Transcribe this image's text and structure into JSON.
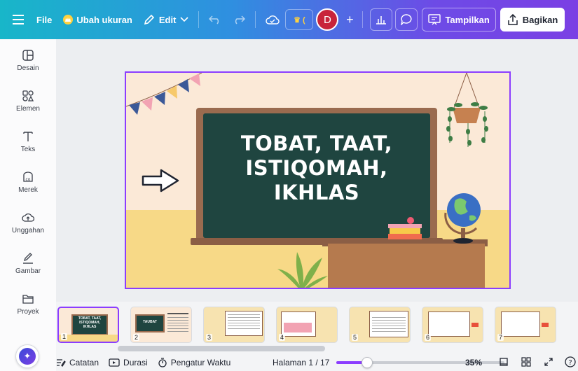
{
  "topbar": {
    "file_label": "File",
    "resize_label": "Ubah ukuran",
    "edit_label": "Edit",
    "avatar_initial": "D",
    "present_label": "Tampilkan",
    "share_label": "Bagikan"
  },
  "sidebar": {
    "items": [
      {
        "label": "Desain",
        "icon": "layout-icon"
      },
      {
        "label": "Elemen",
        "icon": "shapes-icon"
      },
      {
        "label": "Teks",
        "icon": "text-icon"
      },
      {
        "label": "Merek",
        "icon": "brand-icon"
      },
      {
        "label": "Unggahan",
        "icon": "upload-icon"
      },
      {
        "label": "Gambar",
        "icon": "draw-icon"
      },
      {
        "label": "Proyek",
        "icon": "folder-icon"
      }
    ]
  },
  "slide": {
    "title": "TOBAT, TAAT,\nISTIQOMAH,\nIKHLAS"
  },
  "pages": {
    "thumbs": [
      "1",
      "2",
      "3",
      "4",
      "5",
      "6",
      "7"
    ],
    "thumb1_text": "TOBAT, TAAT,\nISTIQOMAH,\nIKHLAS",
    "thumb2_text": "TAUBAT"
  },
  "bottombar": {
    "notes_label": "Catatan",
    "duration_label": "Durasi",
    "timer_label": "Pengatur Waktu",
    "page_indicator": "Halaman 1 / 17",
    "zoom_label": "35%",
    "zoom_value": 35
  },
  "colors": {
    "accent": "#8b3dff",
    "board": "#1f4540",
    "wall": "#fbe9d7",
    "floor": "#f7d987"
  }
}
